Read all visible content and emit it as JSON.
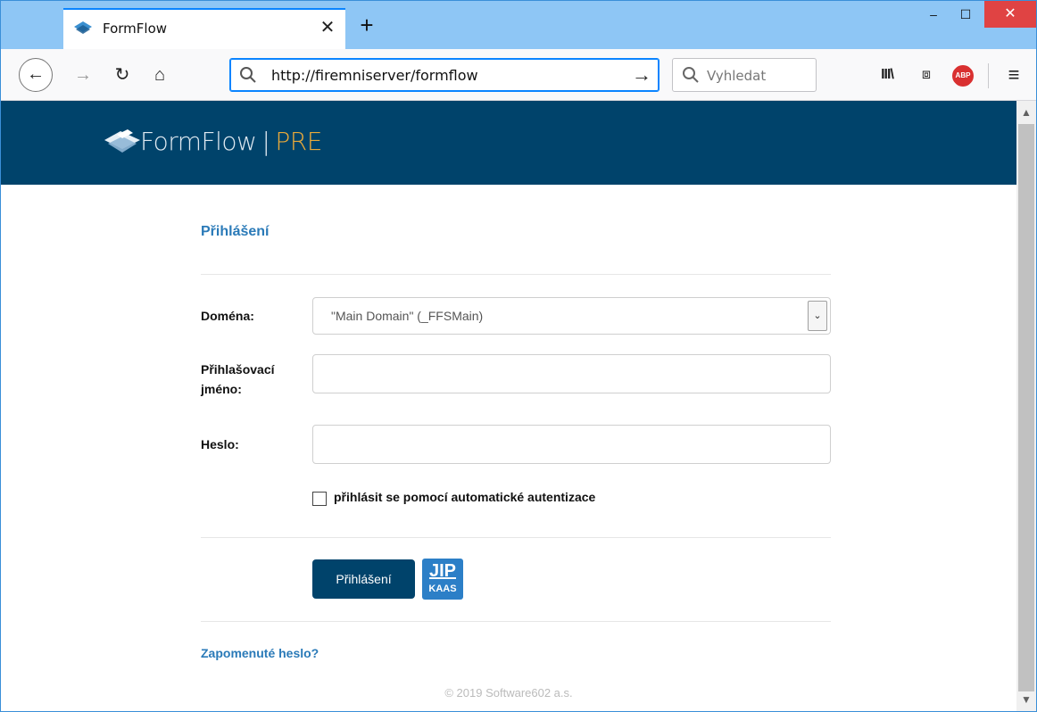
{
  "browser": {
    "tab_title": "FormFlow",
    "tab_close": "✕",
    "new_tab": "+",
    "url": "http://firemniserver/formflow",
    "search_placeholder": "Vyhledat",
    "window_controls": {
      "minimize": "–",
      "maximize": "☐",
      "close": "✕"
    },
    "toolbar": {
      "back": "←",
      "forward": "→",
      "reload": "↻",
      "home": "⌂",
      "go": "→",
      "library": "III\\",
      "sidebar": "⧈",
      "adblock": "ABP",
      "menu": "≡"
    },
    "scroll": {
      "up": "▲",
      "down": "▼"
    },
    "accent_color": "#0a84ff"
  },
  "header": {
    "brand": "FormFlow",
    "separator": "|",
    "environment": "PRE",
    "background_color": "#00436b"
  },
  "login": {
    "title": "Přihlášení",
    "domain_label": "Doména:",
    "domain_value": "\"Main Domain\" (_FFSMain)",
    "username_label_line1": "Přihlašovací",
    "username_label_line2": "jméno:",
    "username_value": "",
    "password_label": "Heslo:",
    "password_value": "",
    "auto_auth_label": "přihlásit se pomocí automatické autentizace",
    "auto_auth_checked": false,
    "submit_label": "Přihlášení",
    "jip_top": "JIP",
    "jip_bottom": "KAAS",
    "forgot_link": "Zapomenuté heslo?"
  },
  "footer": {
    "copyright": "© 2019 Software602 a.s."
  }
}
